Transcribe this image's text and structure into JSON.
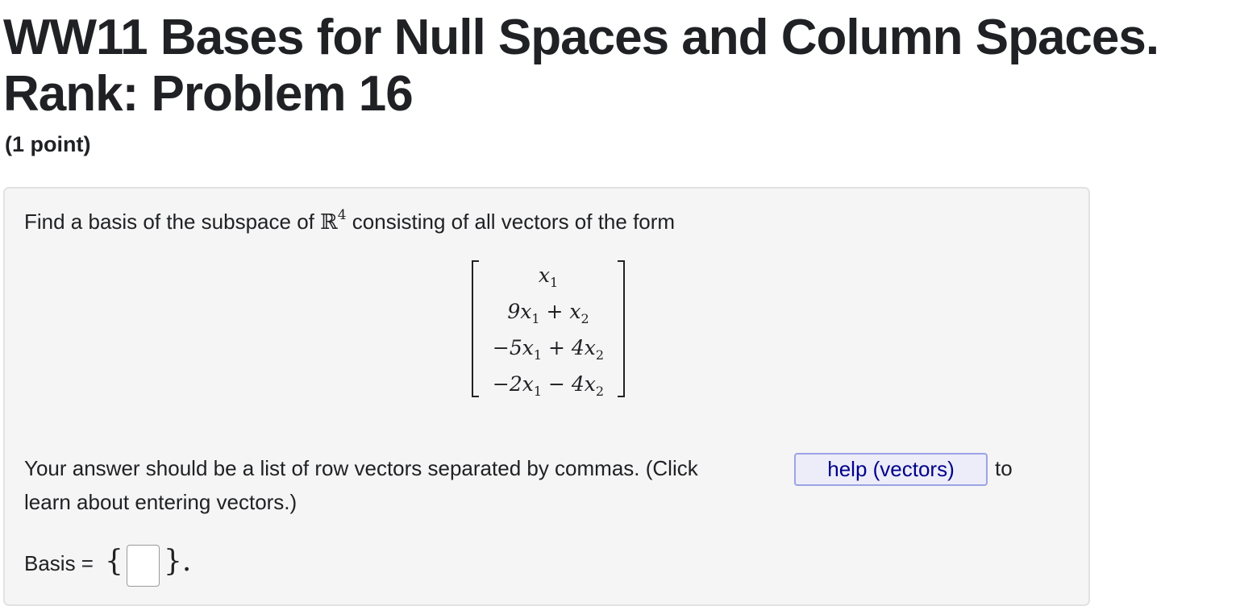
{
  "header": {
    "title": "WW11 Bases for Null Spaces and Column Spaces. Rank: Problem 16",
    "points": "(1 point)"
  },
  "problem": {
    "intro_before": "Find a basis of the subspace of ",
    "space_symbol": "ℝ",
    "space_exponent": "4",
    "intro_after": " consisting of all vectors of the form",
    "matrix_rows": [
      [
        "x",
        "1",
        "",
        "",
        ""
      ],
      [
        "9x",
        "1",
        " + x",
        "2",
        ""
      ],
      [
        "−5x",
        "1",
        " + 4x",
        "2",
        ""
      ],
      [
        "−2x",
        "1",
        " − 4x",
        "2",
        ""
      ]
    ],
    "instructions_line1_before": "Your answer should be a list of row vectors separated by commas. (Click",
    "help_button_label": "help (vectors)",
    "instructions_line1_after": "to",
    "instructions_line2": "learn about entering vectors.)",
    "answer_label": "Basis = ",
    "brace_open": "{",
    "brace_close": "}.",
    "answer_value": ""
  }
}
